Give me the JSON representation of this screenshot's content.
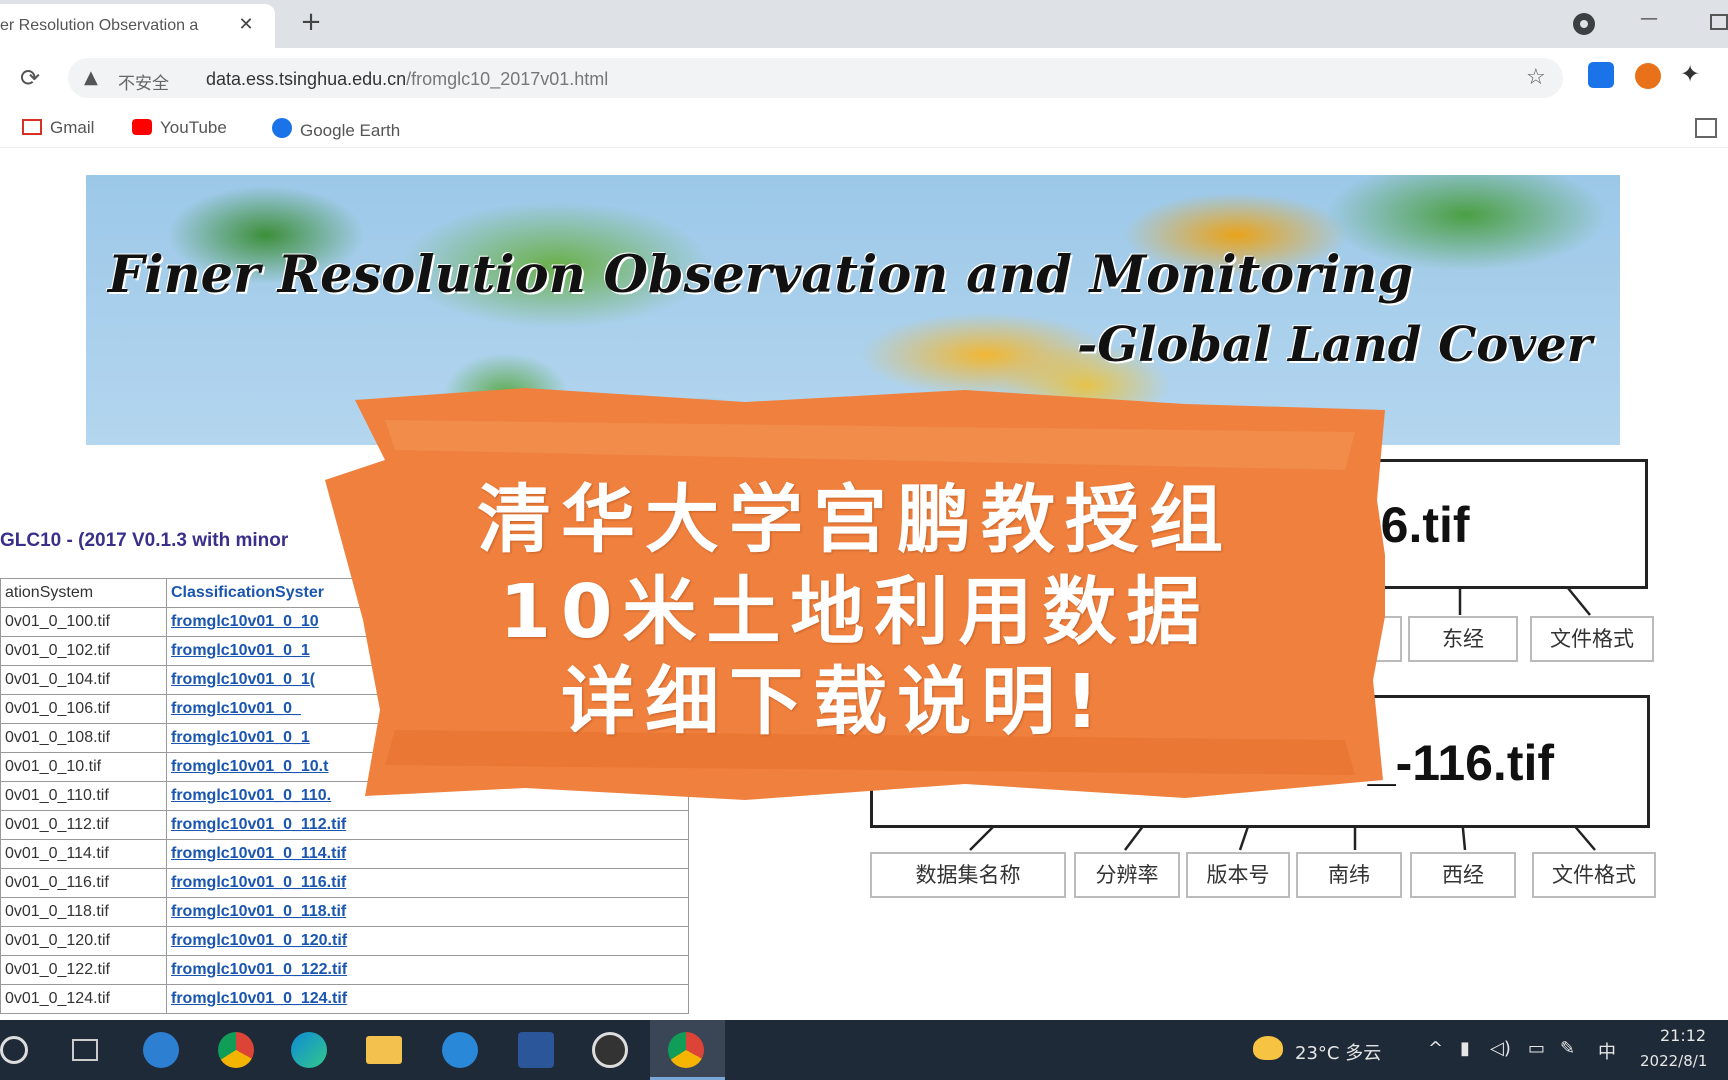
{
  "browser": {
    "tab_title": "er Resolution Observation a",
    "tab_close": "✕",
    "new_tab": "+",
    "security_label": "不安全",
    "url_domain": "data.ess.tsinghua.edu.cn",
    "url_path": "/fromglc10_2017v01.html",
    "bookmarks": [
      "Gmail",
      "YouTube",
      "Google Earth"
    ]
  },
  "banner": {
    "title": "Finer Resolution Observation and Monitoring",
    "subtitle": "-Global Land Cover"
  },
  "dataset": {
    "heading": "GLC10 - (2017 V0.1.3 with minor",
    "header": [
      "ationSystem",
      "ClassificationSyster"
    ],
    "rows": [
      [
        "0v01_0_100.tif",
        "fromglc10v01_0_10"
      ],
      [
        "0v01_0_102.tif",
        "fromglc10v01_0_1"
      ],
      [
        "0v01_0_104.tif",
        "fromglc10v01_0_1("
      ],
      [
        "0v01_0_106.tif",
        "fromglc10v01_0_"
      ],
      [
        "0v01_0_108.tif",
        "fromglc10v01_0_1"
      ],
      [
        "0v01_0_10.tif",
        "fromglc10v01_0_10.t"
      ],
      [
        "0v01_0_110.tif",
        "fromglc10v01_0_110."
      ],
      [
        "0v01_0_112.tif",
        "fromglc10v01_0_112.tif"
      ],
      [
        "0v01_0_114.tif",
        "fromglc10v01_0_114.tif"
      ],
      [
        "0v01_0_116.tif",
        "fromglc10v01_0_116.tif"
      ],
      [
        "0v01_0_118.tif",
        "fromglc10v01_0_118.tif"
      ],
      [
        "0v01_0_120.tif",
        "fromglc10v01_0_120.tif"
      ],
      [
        "0v01_0_122.tif",
        "fromglc10v01_0_122.tif"
      ],
      [
        "0v01_0_124.tif",
        "fromglc10v01_0_124.tif"
      ]
    ]
  },
  "diagram": {
    "top_filename": "_116.tif",
    "top_labels": [
      "东经",
      "文件格式"
    ],
    "bottom_filename": "8_-116.tif",
    "bottom_labels": [
      "数据集名称",
      "分辨率",
      "版本号",
      "南纬",
      "西经",
      "文件格式"
    ]
  },
  "promo": {
    "line1": "清华大学宫鹏教授组",
    "line2": "10米土地利用数据",
    "line3": "详细下载说明!"
  },
  "taskbar": {
    "weather": "23°C 多云",
    "time": "21:12",
    "date": "2022/8/1",
    "ime": "中"
  },
  "colors": {
    "promo_orange": "#f0803d",
    "link_blue": "#1a56b0",
    "heading_purple": "#3a2f8a"
  }
}
